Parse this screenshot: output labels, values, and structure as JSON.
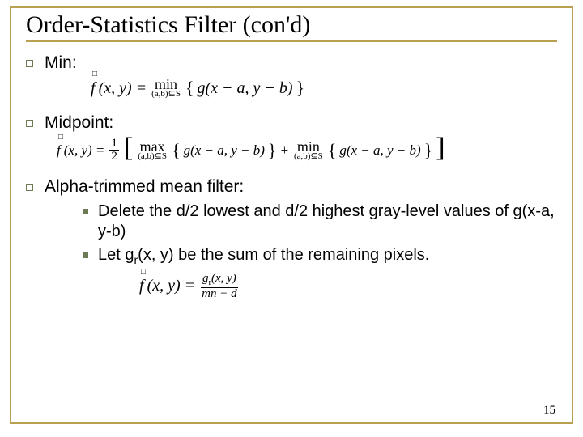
{
  "title": "Order-Statistics Filter (con'd)",
  "items": {
    "min": {
      "label": "Min:"
    },
    "midpoint": {
      "label": "Midpoint:"
    },
    "alpha": {
      "label": "Alpha-trimmed mean filter:",
      "sub1": "Delete the d/2 lowest and d/2 highest gray-level values of g(x-a, y-b)",
      "sub2_pre": "Let g",
      "sub2_subscript": "r",
      "sub2_post": "(x, y) be the sum of the remaining pixels."
    }
  },
  "formulas": {
    "min": {
      "lhs_f": "f",
      "lhs_args": "(x, y) =",
      "op": "min",
      "opsub": "(a,b)⊆S",
      "body": "g(x − a, y − b)"
    },
    "midpoint": {
      "lhs_f": "f",
      "lhs_args": "(x, y) =",
      "half_num": "1",
      "half_den": "2",
      "max_op": "max",
      "max_sub": "(a,b)⊆S",
      "min_op": "min",
      "min_sub": "(a,b)⊆S",
      "body1": "g(x − a, y − b)",
      "plus": "+",
      "body2": "g(x − a, y − b)"
    },
    "alpha": {
      "lhs_f": "f",
      "lhs_args": "(x, y) =",
      "num_g": "g",
      "num_sub": "r",
      "num_args": "(x, y)",
      "den": "mn − d"
    }
  },
  "page": "15"
}
